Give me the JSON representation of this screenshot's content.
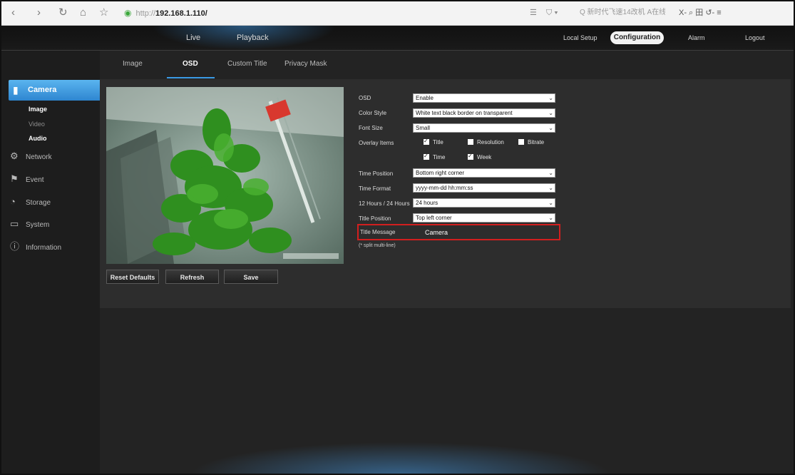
{
  "browser": {
    "url_protocol": "http://",
    "url_host": "192.168.1.110/",
    "search_text": "Q 新时代飞速14改机  A在线",
    "search_brand": "A在线",
    "right_tools": "X- ⌕ 田 ↺- ≡"
  },
  "topnav": {
    "live": "Live",
    "playback": "Playback",
    "local_setup": "Local Setup",
    "configuration": "Configuration",
    "alarm": "Alarm",
    "logout": "Logout"
  },
  "sidebar": {
    "camera": "Camera",
    "sub": [
      "Image",
      "Video",
      "Audio"
    ],
    "items": [
      "Network",
      "Event",
      "Storage",
      "System",
      "Information"
    ]
  },
  "tabs": [
    "Image",
    "OSD",
    "Custom Title",
    "Privacy Mask"
  ],
  "buttons": {
    "reset": "Reset Defaults",
    "refresh": "Refresh",
    "save": "Save"
  },
  "form": {
    "osd_label": "OSD",
    "osd_value": "Enable",
    "color_style_label": "Color Style",
    "color_style_value": "White text black border on transparent",
    "font_size_label": "Font Size",
    "font_size_value": "Small",
    "overlay_label": "Overlay Items",
    "overlay_items": [
      {
        "label": "Title",
        "checked": true
      },
      {
        "label": "Resolution",
        "checked": false
      },
      {
        "label": "Bitrate",
        "checked": false
      },
      {
        "label": "Time",
        "checked": true
      },
      {
        "label": "Week",
        "checked": true
      }
    ],
    "time_position_label": "Time Position",
    "time_position_value": "Bottom right corner",
    "time_format_label": "Time Format",
    "time_format_value": "yyyy-mm-dd hh:mm:ss",
    "hours_label": "12 Hours / 24 Hours",
    "hours_value": "24 hours",
    "title_position_label": "Title Position",
    "title_position_value": "Top left corner",
    "title_message_label": "Title Message",
    "title_message_value": "Camera",
    "hint": "(* split multi-line)"
  },
  "colors": {
    "accent": "#2e86d0",
    "highlight_border": "#d21f1f",
    "panel": "#2d2d2d"
  }
}
